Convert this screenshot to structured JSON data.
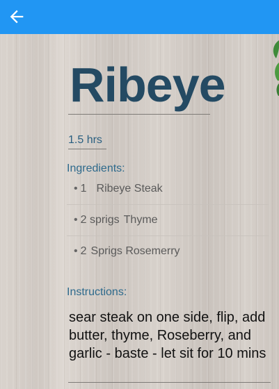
{
  "colors": {
    "appbar": "#2196f3",
    "title": "#244a63",
    "label": "#2e6a8c"
  },
  "appbar": {
    "back_icon": "arrow-left"
  },
  "recipe": {
    "title": "Ribeye",
    "time": "1.5 hrs",
    "ingredients_label": "Ingredients:",
    "ingredients": [
      {
        "qty": "1",
        "name": "Ribeye Steak"
      },
      {
        "qty": "2 sprigs",
        "name": "Thyme"
      },
      {
        "qty": "2",
        "name": "Sprigs Rosemerry"
      }
    ],
    "instructions_label": "Instructions:",
    "instructions": "sear steak on one side, flip, add butter, thyme, Roseberry, and garlic - baste - let sit for 10 mins"
  }
}
